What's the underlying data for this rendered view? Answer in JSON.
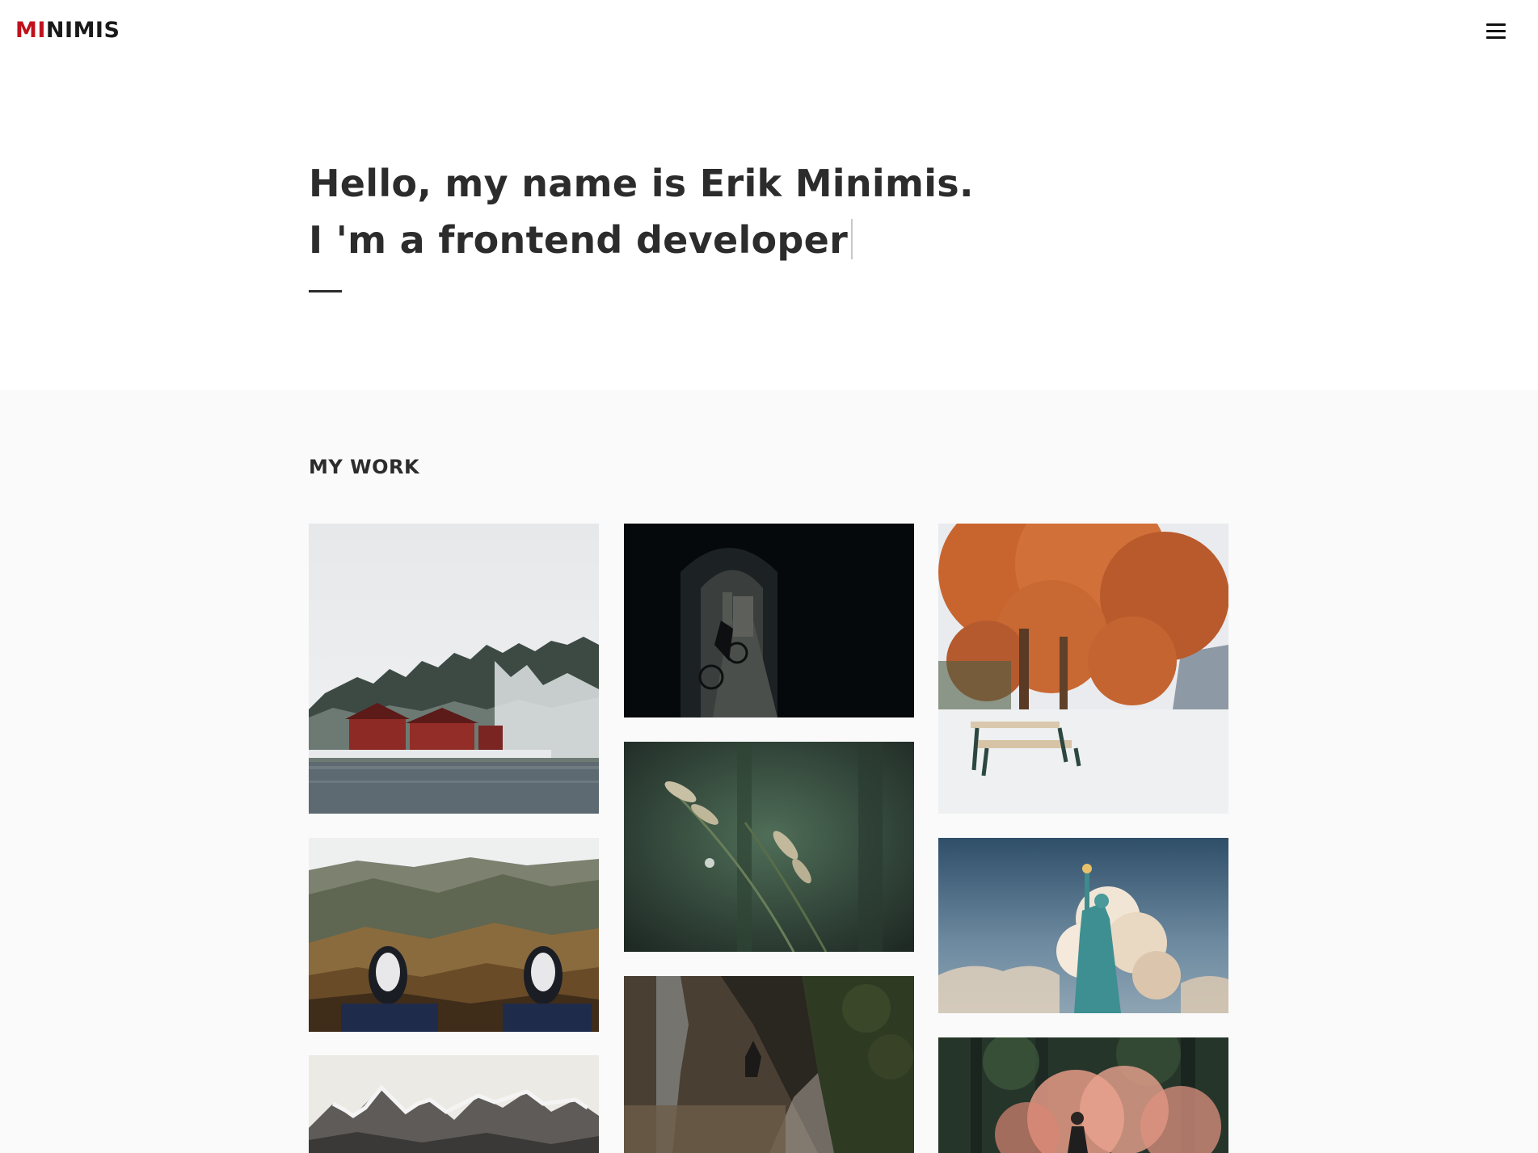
{
  "header": {
    "logo_accent": "MI",
    "logo_rest": "NIMIS",
    "brand_color": "#c0111c"
  },
  "hero": {
    "line1": "Hello, my name is Erik Minimis.",
    "line2": "I 'm a frontend developer"
  },
  "work": {
    "heading": "MY WORK",
    "items": [
      {
        "name": "snowy-lakeside-village-photo",
        "subject": "red houses by a lake in snowy forest"
      },
      {
        "name": "dark-tunnel-cyclist-photo",
        "subject": "cyclist in a dark tunnel alley"
      },
      {
        "name": "autumn-tree-bench-photo",
        "subject": "orange autumn tree and bench in snow"
      },
      {
        "name": "sneakers-over-valley-photo",
        "subject": "sneakers dangling over mountain valley"
      },
      {
        "name": "grass-dew-macro-photo",
        "subject": "grass seed heads with dew drop"
      },
      {
        "name": "statue-of-liberty-photo",
        "subject": "statue of liberty against clouds"
      },
      {
        "name": "mountain-range-photo",
        "subject": "snowy mountain range"
      },
      {
        "name": "waterfall-rocks-photo",
        "subject": "person sitting by waterfall rocks"
      },
      {
        "name": "smoke-bomb-forest-photo",
        "subject": "person with pink smoke in forest"
      }
    ]
  }
}
